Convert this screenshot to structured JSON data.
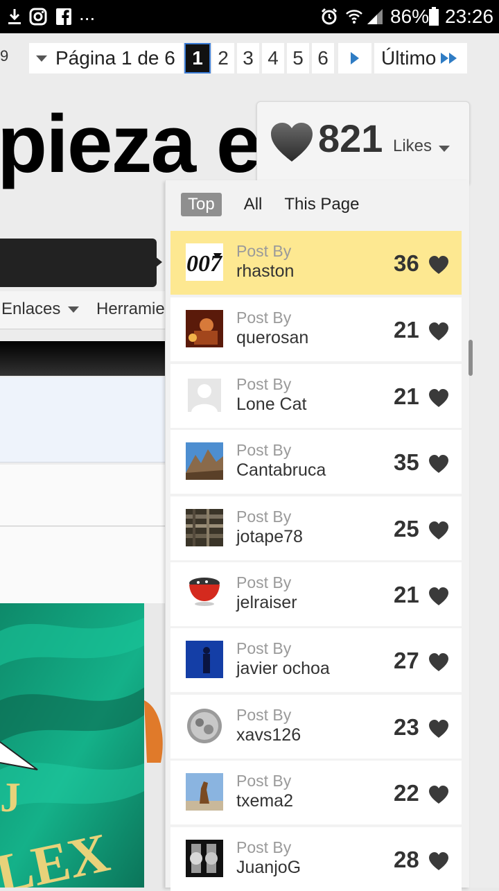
{
  "status_bar": {
    "battery": "86%",
    "time": "23:26",
    "more": "..."
  },
  "pager": {
    "prev_fragment": "9",
    "label": "Página 1 de 6",
    "pages": [
      "1",
      "2",
      "3",
      "4",
      "5",
      "6"
    ],
    "current": "1",
    "last_label": "Último"
  },
  "thread_title_fragment": "pieza el",
  "likes": {
    "count": "821",
    "label": "Likes"
  },
  "tabs": [
    "Top",
    "All",
    "This Page"
  ],
  "nav": {
    "links_label": "Enlaces",
    "tools_label": "Herramie"
  },
  "rows": [
    {
      "post_by": "Post By",
      "user": "rhaston",
      "count": "36",
      "avatar": "007-logo"
    },
    {
      "post_by": "Post By",
      "user": "querosan",
      "count": "21",
      "avatar": "painting"
    },
    {
      "post_by": "Post By",
      "user": "Lone Cat",
      "count": "21",
      "avatar": "default-user"
    },
    {
      "post_by": "Post By",
      "user": "Cantabruca",
      "count": "35",
      "avatar": "mountains"
    },
    {
      "post_by": "Post By",
      "user": "jotape78",
      "count": "25",
      "avatar": "city-aerial"
    },
    {
      "post_by": "Post By",
      "user": "jelraiser",
      "count": "21",
      "avatar": "cup"
    },
    {
      "post_by": "Post By",
      "user": "javier ochoa",
      "count": "27",
      "avatar": "silhouette"
    },
    {
      "post_by": "Post By",
      "user": "xavs126",
      "count": "23",
      "avatar": "watch-movement"
    },
    {
      "post_by": "Post By",
      "user": "txema2",
      "count": "22",
      "avatar": "dog-statue"
    },
    {
      "post_by": "Post By",
      "user": "JuanjoG",
      "count": "28",
      "avatar": "watches"
    }
  ],
  "colors": {
    "highlight_row": "#fde891",
    "heart": "#3a3a3a",
    "next_arrow": "#2f7cc4"
  }
}
